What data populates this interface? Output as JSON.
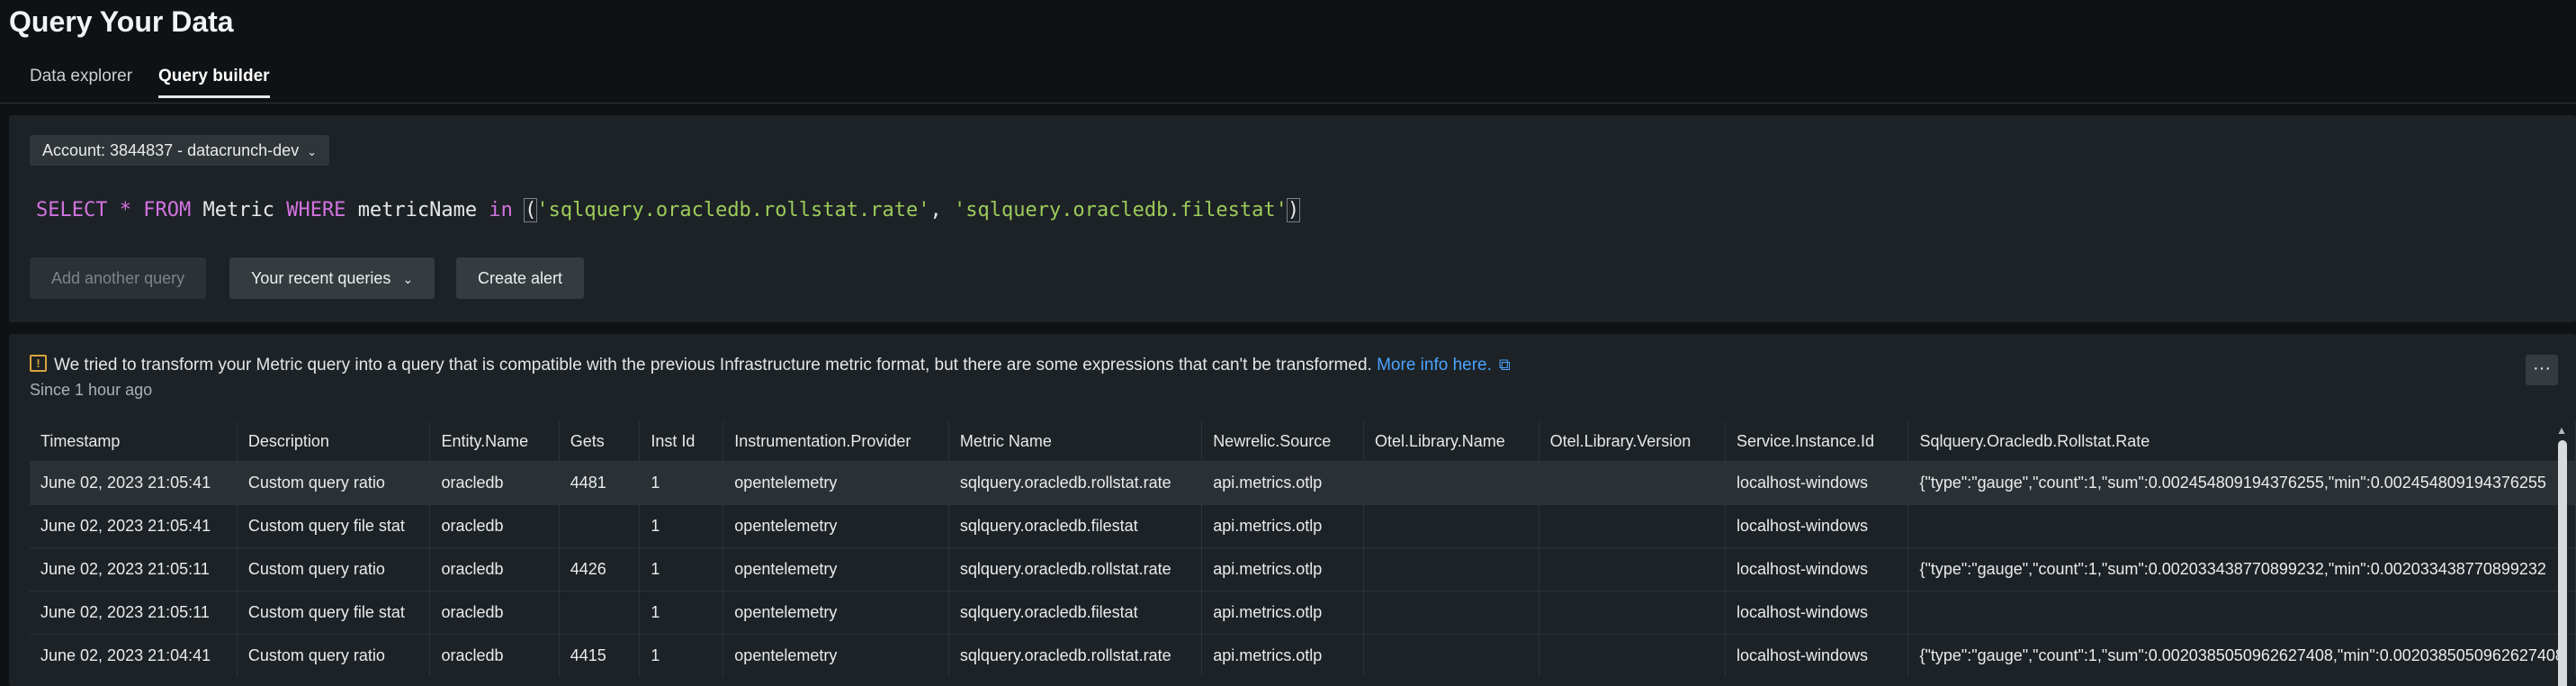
{
  "page": {
    "title": "Query Your Data"
  },
  "tabs": [
    {
      "label": "Data explorer",
      "active": false
    },
    {
      "label": "Query builder",
      "active": true
    }
  ],
  "query_panel": {
    "account_label": "Account: 3844837 - datacrunch-dev",
    "query": {
      "select": "SELECT",
      "star": "*",
      "from": "FROM",
      "table": "Metric",
      "where": "WHERE",
      "field": "metricName",
      "op": "in",
      "open_paren": "(",
      "value1": "'sqlquery.oracledb.rollstat.rate'",
      "comma": ", ",
      "value2": "'sqlquery.oracledb.filestat'",
      "close_paren": ")"
    },
    "buttons": {
      "add_query": "Add another query",
      "recent_queries": "Your recent queries",
      "create_alert": "Create alert"
    }
  },
  "results": {
    "notice": "We tried to transform your Metric query into a query that is compatible with the previous Infrastructure metric format, but there are some expressions that can't be transformed.",
    "more_info": "More info here.",
    "since": "Since 1 hour ago",
    "more_button": "···",
    "columns": [
      "Timestamp",
      "Description",
      "Entity.Name",
      "Gets",
      "Inst Id",
      "Instrumentation.Provider",
      "Metric Name",
      "Newrelic.Source",
      "Otel.Library.Name",
      "Otel.Library.Version",
      "Service.Instance.Id",
      "Sqlquery.Oracledb.Rollstat.Rate"
    ],
    "rows": [
      [
        "June 02, 2023 21:05:41",
        "Custom query ratio",
        "oracledb",
        "4481",
        "1",
        "opentelemetry",
        "sqlquery.oracledb.rollstat.rate",
        "api.metrics.otlp",
        "",
        "",
        "localhost-windows",
        "{\"type\":\"gauge\",\"count\":1,\"sum\":0.002454809194376255,\"min\":0.002454809194376255"
      ],
      [
        "June 02, 2023 21:05:41",
        "Custom query file stat",
        "oracledb",
        "",
        "1",
        "opentelemetry",
        "sqlquery.oracledb.filestat",
        "api.metrics.otlp",
        "",
        "",
        "localhost-windows",
        ""
      ],
      [
        "June 02, 2023 21:05:11",
        "Custom query ratio",
        "oracledb",
        "4426",
        "1",
        "opentelemetry",
        "sqlquery.oracledb.rollstat.rate",
        "api.metrics.otlp",
        "",
        "",
        "localhost-windows",
        "{\"type\":\"gauge\",\"count\":1,\"sum\":0.002033438770899232,\"min\":0.002033438770899232"
      ],
      [
        "June 02, 2023 21:05:11",
        "Custom query file stat",
        "oracledb",
        "",
        "1",
        "opentelemetry",
        "sqlquery.oracledb.filestat",
        "api.metrics.otlp",
        "",
        "",
        "localhost-windows",
        ""
      ],
      [
        "June 02, 2023 21:04:41",
        "Custom query ratio",
        "oracledb",
        "4415",
        "1",
        "opentelemetry",
        "sqlquery.oracledb.rollstat.rate",
        "api.metrics.otlp",
        "",
        "",
        "localhost-windows",
        "{\"type\":\"gauge\",\"count\":1,\"sum\":0.00203850509626274​08,\"min\":0.00203850509626274​08"
      ]
    ]
  }
}
